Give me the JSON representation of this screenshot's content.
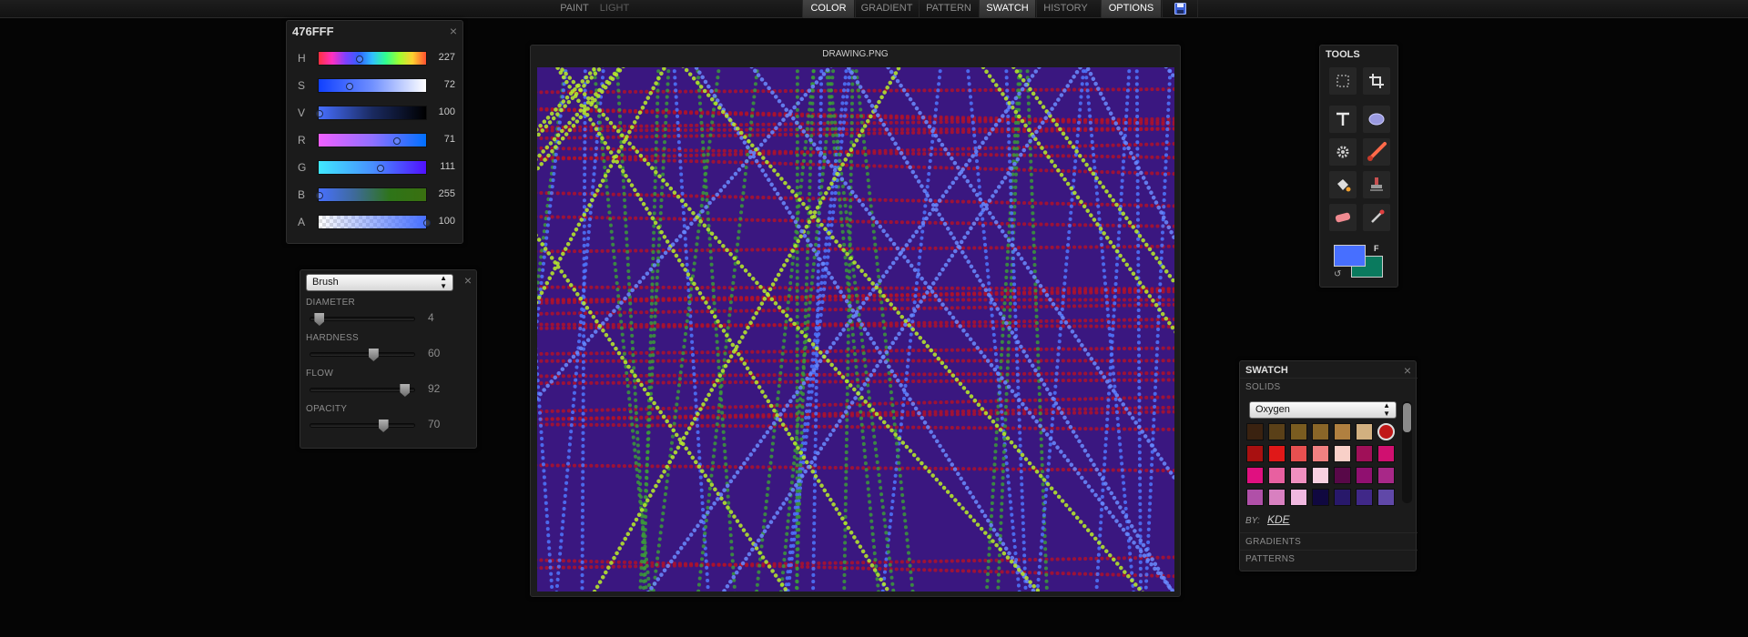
{
  "topbar": {
    "left": [
      {
        "label": "PAINT",
        "state": "normal"
      },
      {
        "label": "LIGHT",
        "state": "dim"
      }
    ],
    "tabs": [
      {
        "label": "COLOR",
        "active": true
      },
      {
        "label": "GRADIENT",
        "active": false
      },
      {
        "label": "PATTERN",
        "active": false
      },
      {
        "label": "SWATCH",
        "active": true
      },
      {
        "label": "HISTORY",
        "active": false
      },
      {
        "label": "OPTIONS",
        "active": true
      }
    ],
    "save_icon": "floppy-disk-icon"
  },
  "color_panel": {
    "hex": "476FFF",
    "close_glyph": "×",
    "channels": [
      {
        "label": "H",
        "value": "227",
        "fraction": 0.37
      },
      {
        "label": "S",
        "value": "72",
        "fraction": 0.28
      },
      {
        "label": "V",
        "value": "100",
        "fraction": 0.0
      },
      {
        "label": "R",
        "value": "71",
        "fraction": 0.72
      },
      {
        "label": "G",
        "value": "111",
        "fraction": 0.57
      },
      {
        "label": "B",
        "value": "255",
        "fraction": 0.0
      },
      {
        "label": "A",
        "value": "100",
        "fraction": 1.0
      }
    ]
  },
  "brush_panel": {
    "tool": "Brush",
    "close_glyph": "×",
    "sliders": [
      {
        "label": "DIAMETER",
        "value": "4",
        "fraction": 0.05
      },
      {
        "label": "HARDNESS",
        "value": "60",
        "fraction": 0.6
      },
      {
        "label": "FLOW",
        "value": "92",
        "fraction": 0.92
      },
      {
        "label": "OPACITY",
        "value": "70",
        "fraction": 0.7
      }
    ]
  },
  "canvas": {
    "title": "DRAWING.PNG"
  },
  "tools": {
    "title": "TOOLS",
    "items": [
      "marquee-select-icon",
      "crop-icon",
      "text-icon",
      "ellipse-shape-icon",
      "settings-gear-icon",
      "paint-brush-icon",
      "paint-bucket-icon",
      "stamp-icon",
      "eraser-icon",
      "eyedropper-icon"
    ],
    "foreground_color": "#476FFF",
    "background_color": "#0A7A5E",
    "fg_label": "F"
  },
  "swatch_panel": {
    "title": "SWATCH",
    "close_glyph": "×",
    "section_solids": "SOLIDS",
    "palette_select": "Oxygen",
    "colors": [
      "#3a2210",
      "#5a4018",
      "#7a5c20",
      "#8a6628",
      "#b08040",
      "#d2b080",
      "#c01818",
      "#a81010",
      "#e01818",
      "#e85050",
      "#f08080",
      "#f8d0c8",
      "#a01058",
      "#d01070",
      "#e01080",
      "#e860a0",
      "#f090c0",
      "#f8d0e0",
      "#580848",
      "#901070",
      "#a82888",
      "#b050a8",
      "#d880c0",
      "#f0b8e0",
      "#100840",
      "#28186a",
      "#402888",
      "#6048a8"
    ],
    "by_label": "BY:",
    "by_author": "KDE",
    "section_gradients": "GRADIENTS",
    "section_patterns": "PATTERNS"
  }
}
